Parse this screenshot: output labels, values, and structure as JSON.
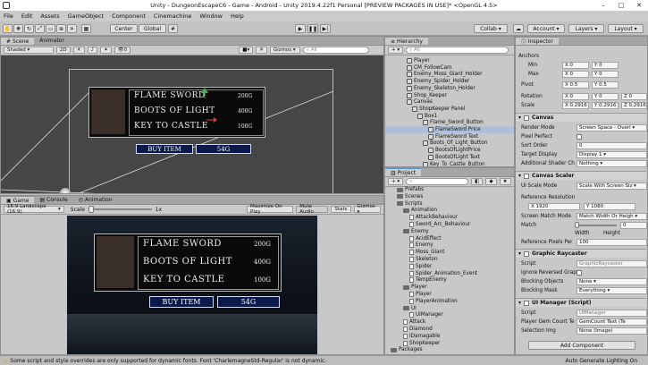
{
  "window": {
    "title": "Unity - DungeonEscapeC6 - Game - Android - Unity 2019.4.22f1 Personal [PREVIEW PACKAGES IN USE]* <OpenGL 4.5>"
  },
  "menu": [
    "File",
    "Edit",
    "Assets",
    "GameObject",
    "Component",
    "Cinemachine",
    "Window",
    "Help"
  ],
  "toolbar": {
    "center_label": "Center",
    "global_label": "Global",
    "collab_label": "Collab ▾",
    "account_label": "Account ▾",
    "layers_label": "Layers ▾",
    "layout_label": "Layout ▾"
  },
  "scene": {
    "tabs": [
      "Scene",
      "Animator"
    ],
    "shading": "Shaded",
    "mode_2d": "2D",
    "gizmos_label": "Gizmos ▾",
    "search_placeholder": "All",
    "layer_count": "0"
  },
  "shop": {
    "items": [
      {
        "name": "FLAME SWORD",
        "price": "200G"
      },
      {
        "name": "BOOTS OF LIGHT",
        "price": "400G"
      },
      {
        "name": "KEY TO CASTLE",
        "price": "100G"
      }
    ],
    "buy_label": "BUY ITEM",
    "gems": "54G"
  },
  "game": {
    "tabs": [
      "Game",
      "Console",
      "Animation"
    ],
    "aspect": "16:9 Landscape (16:9)",
    "scale_label": "Scale",
    "scale_value": "1x",
    "options": [
      "Maximize On Play",
      "Mute Audio",
      "Stats",
      "Gizmos ▾"
    ]
  },
  "hierarchy": {
    "tab": "Hierarchy",
    "add_label": "+ ▾",
    "search_placeholder": "All",
    "items": [
      {
        "label": "Player",
        "depth": 0
      },
      {
        "label": "CM_FollowCam",
        "depth": 0
      },
      {
        "label": "Enemy_Moss_Giant_Holder",
        "depth": 0
      },
      {
        "label": "Enemy_Spider_Holder",
        "depth": 0
      },
      {
        "label": "Enemy_Skeleton_Holder",
        "depth": 0
      },
      {
        "label": "Shop_Keeper",
        "depth": 0
      },
      {
        "label": "Canvas",
        "depth": 0
      },
      {
        "label": "ShopKeeper Panel",
        "depth": 1
      },
      {
        "label": "Box1",
        "depth": 2
      },
      {
        "label": "Flame_Sword_Button",
        "depth": 3
      },
      {
        "label": "FlameSword Price",
        "depth": 4,
        "selected": true
      },
      {
        "label": "FlameSword Text",
        "depth": 4
      },
      {
        "label": "Boots_Of_Light_Button",
        "depth": 3
      },
      {
        "label": "BootsOfLightPrice",
        "depth": 4
      },
      {
        "label": "BootsOfLight Text",
        "depth": 4
      },
      {
        "label": "Key_To_Castle_Button",
        "depth": 3
      }
    ]
  },
  "project": {
    "tab": "Project",
    "items": [
      {
        "label": "Prefabs",
        "depth": 1,
        "type": "folder"
      },
      {
        "label": "Scenes",
        "depth": 1,
        "type": "folder"
      },
      {
        "label": "Scripts",
        "depth": 1,
        "type": "folder"
      },
      {
        "label": "Animation",
        "depth": 2,
        "type": "folder"
      },
      {
        "label": "AttackBehaviour",
        "depth": 3,
        "type": "script"
      },
      {
        "label": "Sword_Arc_Behaviour",
        "depth": 3,
        "type": "script"
      },
      {
        "label": "Enemy",
        "depth": 2,
        "type": "folder"
      },
      {
        "label": "AcidEffect",
        "depth": 3,
        "type": "script"
      },
      {
        "label": "Enemy",
        "depth": 3,
        "type": "script"
      },
      {
        "label": "Moss_Giant",
        "depth": 3,
        "type": "script"
      },
      {
        "label": "Skeleton",
        "depth": 3,
        "type": "script"
      },
      {
        "label": "Spider",
        "depth": 3,
        "type": "script"
      },
      {
        "label": "Spider_Animation_Event",
        "depth": 3,
        "type": "script"
      },
      {
        "label": "TempEnemy",
        "depth": 3,
        "type": "script"
      },
      {
        "label": "Player",
        "depth": 2,
        "type": "folder"
      },
      {
        "label": "Player",
        "depth": 3,
        "type": "script"
      },
      {
        "label": "PlayerAnimation",
        "depth": 3,
        "type": "script"
      },
      {
        "label": "UI",
        "depth": 2,
        "type": "folder"
      },
      {
        "label": "UIManager",
        "depth": 3,
        "type": "script"
      },
      {
        "label": "Attack",
        "depth": 2,
        "type": "script"
      },
      {
        "label": "Diamond",
        "depth": 2,
        "type": "script"
      },
      {
        "label": "IDamagable",
        "depth": 2,
        "type": "script"
      },
      {
        "label": "ShopKeeper",
        "depth": 2,
        "type": "script"
      },
      {
        "label": "Packages",
        "depth": 0,
        "type": "folder"
      }
    ]
  },
  "inspector": {
    "tab": "Inspector",
    "anchors": "Anchors",
    "min": {
      "label": "Min",
      "x": "0",
      "y": "0"
    },
    "max": {
      "label": "Max",
      "x": "0",
      "y": "0"
    },
    "pivot": {
      "label": "Pivot",
      "x": "0.5",
      "y": "0.5"
    },
    "rotation": {
      "label": "Rotation",
      "x": "0",
      "y": "0",
      "z": "0"
    },
    "scale": {
      "label": "Scale",
      "x": "0.2916",
      "y": "0.2916",
      "z": "0.2916"
    },
    "canvas": {
      "title": "Canvas",
      "render_mode": {
        "label": "Render Mode",
        "value": "Screen Space - Overl ▾"
      },
      "pixel_perfect": {
        "label": "Pixel Perfect"
      },
      "sort_order": {
        "label": "Sort Order",
        "value": "0"
      },
      "target_display": {
        "label": "Target Display",
        "value": "Display 1 ▾"
      },
      "shader_ch": {
        "label": "Additional Shader Ch",
        "value": "Nothing ▾"
      }
    },
    "scaler": {
      "title": "Canvas Scaler",
      "ui_scale": {
        "label": "UI Scale Mode",
        "value": "Scale With Screen Siz ▾"
      },
      "ref_res": {
        "label": "Reference Resolution",
        "x": "1920",
        "y": "1080"
      },
      "match_mode": {
        "label": "Screen Match Mode",
        "value": "Match Width Or Heigh ▾"
      },
      "match": {
        "label": "Match",
        "value": "0",
        "left": "Width",
        "right": "Height"
      },
      "ref_ppu": {
        "label": "Reference Pixels Per",
        "value": "100"
      }
    },
    "raycaster": {
      "title": "Graphic Raycaster",
      "script": {
        "label": "Script",
        "value": "GraphicRaycaster"
      },
      "ignore": {
        "label": "Ignore Reversed Grap"
      },
      "blocking_obj": {
        "label": "Blocking Objects",
        "value": "None ▾"
      },
      "blocking_mask": {
        "label": "Blocking Mask",
        "value": "Everything ▾"
      }
    },
    "uimanager": {
      "title": "UI Manager (Script)",
      "script": {
        "label": "Script",
        "value": "UIManager"
      },
      "gem_text": {
        "label": "Player Gem Count Te",
        "value": "GemCount Text (Te"
      },
      "selection": {
        "label": "Selection Img",
        "value": "None (Image)"
      }
    },
    "add_component": "Add Component"
  },
  "status": {
    "message": "Some script and style overrides are only supported for dynamic fonts. Font 'CharlemagneStd-Regular' is not dynamic.",
    "right": "Auto Generate Lighting On"
  }
}
